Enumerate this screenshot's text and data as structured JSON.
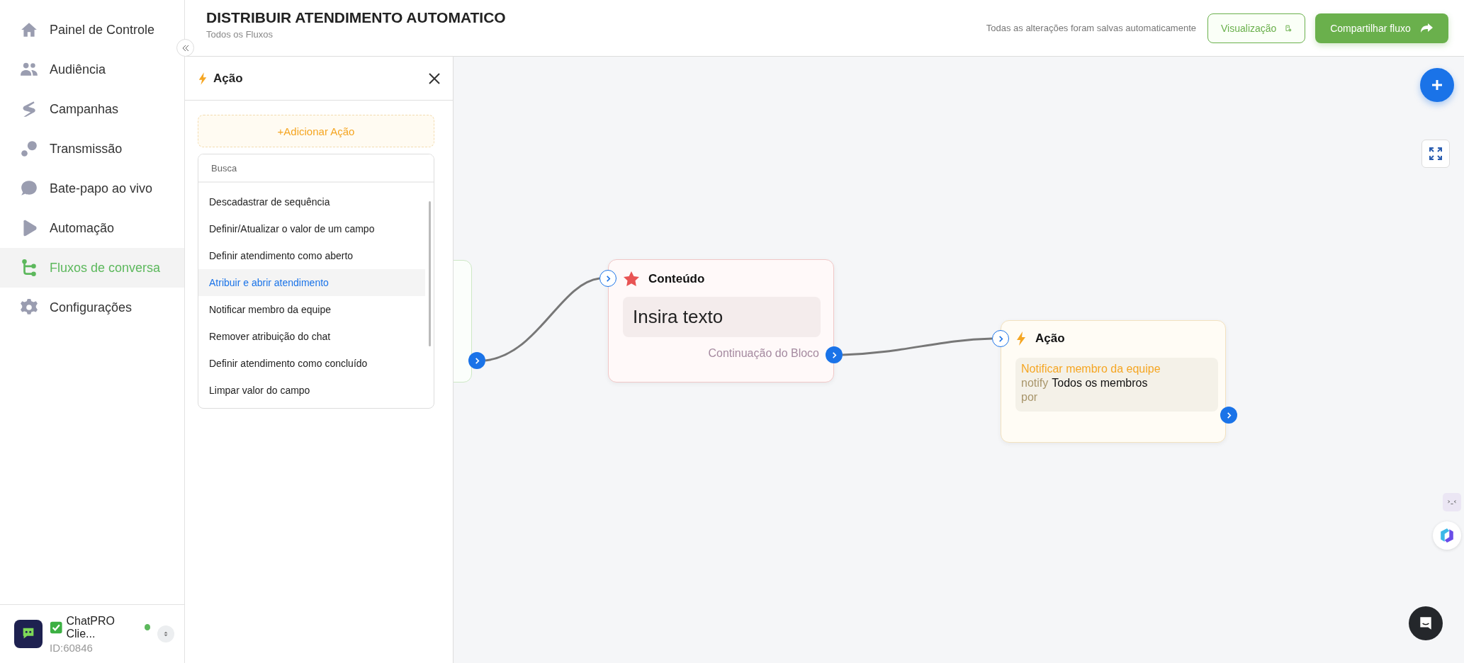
{
  "sidebar": {
    "items": [
      {
        "label": "Painel de Controle",
        "selected": false
      },
      {
        "label": "Audiência",
        "selected": false
      },
      {
        "label": "Campanhas",
        "selected": false
      },
      {
        "label": "Transmissão",
        "selected": false
      },
      {
        "label": "Bate-papo ao vivo",
        "selected": false
      },
      {
        "label": "Automação",
        "selected": false
      },
      {
        "label": "Fluxos de conversa",
        "selected": true
      },
      {
        "label": "Configurações",
        "selected": false
      }
    ],
    "account": {
      "name": "ChatPRO Clie...",
      "id": "ID:60846",
      "online": true
    }
  },
  "header": {
    "title": "DISTRIBUIR ATENDIMENTO AUTOMATICO",
    "breadcrumb": "Todos os Fluxos",
    "save_status": "Todas as alterações foram salvas automaticamente",
    "buttons": [
      {
        "label": "Visualização",
        "kind": "outline"
      },
      {
        "label": "Compartilhar fluxo",
        "kind": "primary"
      }
    ]
  },
  "panel": {
    "title": "Ação",
    "add_button": "+Adicionar Ação",
    "search": {
      "placeholder": "Busca"
    },
    "actions": [
      {
        "label": "Descadastrar de sequência",
        "selected": false
      },
      {
        "label": "Definir/Atualizar o valor de um campo",
        "selected": false
      },
      {
        "label": "Definir atendimento como aberto",
        "selected": false
      },
      {
        "label": "Atribuir e abrir atendimento",
        "selected": true
      },
      {
        "label": "Notificar membro da equipe",
        "selected": false
      },
      {
        "label": "Remover atribuição do chat",
        "selected": false
      },
      {
        "label": "Definir atendimento como concluído",
        "selected": false
      },
      {
        "label": "Limpar valor do campo",
        "selected": false
      }
    ]
  },
  "canvas": {
    "nodes": [
      {
        "kind": "partial"
      },
      {
        "kind": "content",
        "title": "Conteúdo",
        "text": "Insira texto",
        "continuation": "Continuação do Bloco"
      },
      {
        "kind": "action",
        "title": "Ação",
        "action": "Notificar membro da equipe",
        "verb": "notify",
        "target": "Todos os membros",
        "by": "por"
      }
    ]
  }
}
